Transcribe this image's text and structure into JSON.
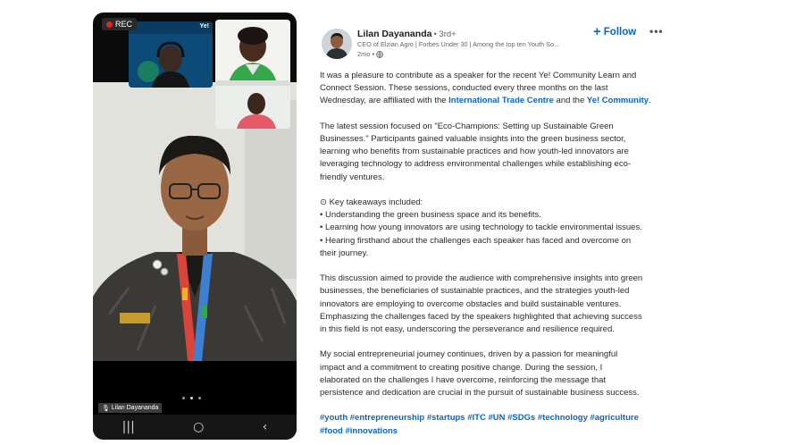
{
  "video": {
    "rec_label": "REC",
    "speaker_name": "Lilan Dayananda",
    "tile_a_badge": "Ye!",
    "nav_icons": [
      "recent-apps-icon",
      "home-icon",
      "back-icon"
    ],
    "nav_glyphs": [
      "|||",
      "○",
      "‹"
    ]
  },
  "post": {
    "author": "Lilan Dayananda",
    "degree": "• 3rd+",
    "headline": "CEO of Elzian Agro | Forbes Under 30 | Among the top ten Youth So...",
    "time": "2mo •",
    "follow_label": "Follow",
    "more_label": "•••",
    "p1_a": "It was a pleasure to contribute as a speaker for the recent Ye! Community Learn and",
    "p1_b": "Connect Session. These sessions, conducted every three months on the last",
    "p1_c_pre": "Wednesday, are affiliated with the ",
    "p1_link1": "International Trade Centre",
    "p1_mid": " and the ",
    "p1_link2": "Ye! Community",
    "p1_end": ".",
    "p2": [
      "The latest session focused on \"Eco-Champions: Setting up Sustainable Green",
      "Businesses.\" Participants gained valuable insights into the green business sector,",
      "learning who benefits from sustainable practices and how youth-led innovators are",
      "leveraging technology to address environmental challenges while establishing eco-",
      "friendly ventures."
    ],
    "p3": [
      "⊙ Key takeaways included:",
      "• Understanding the green business space and its benefits.",
      "• Learning how young innovators are using technology to tackle environmental issues.",
      "• Hearing firsthand about the challenges each speaker has faced and overcome on",
      "their journey."
    ],
    "p4": [
      "This discussion aimed to provide the audience with comprehensive insights into green",
      "businesses, the beneficiaries of sustainable practices, and the strategies youth-led",
      "innovators are employing to overcome obstacles and build sustainable ventures.",
      "Emphasizing the challenges faced by the speakers highlighted that achieving success",
      "in this field is not easy, underscoring the perseverance and resilience required."
    ],
    "p5": [
      "My social entrepreneurial journey continues, driven by a passion for meaningful",
      "impact and a commitment to creating positive change. During the session, I",
      "elaborated on the challenges I have overcome, reinforcing the message that",
      "persistence and dedication are crucial in the pursuit of sustainable business success."
    ],
    "hashtags_line1": "#youth #entrepreneurship #startups #ITC #UN #SDGs #technology #agriculture",
    "hashtags_line2": "#food #innovations"
  },
  "colors": {
    "link": "#0a66c2",
    "rec_dot": "#e02424"
  }
}
